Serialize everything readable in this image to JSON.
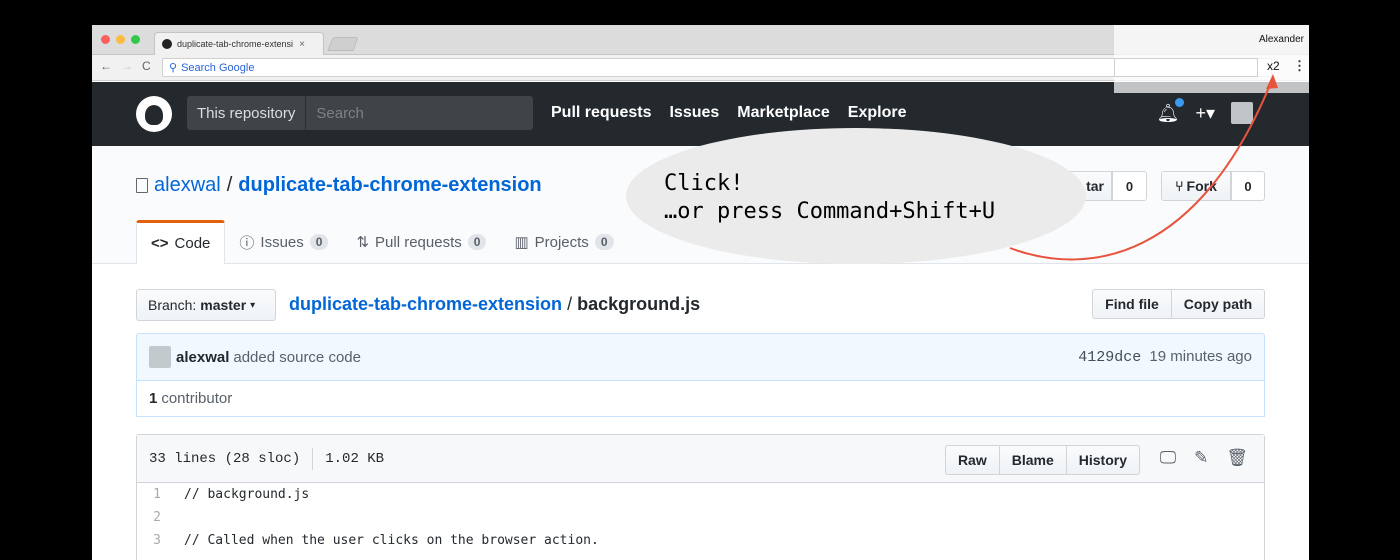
{
  "browser": {
    "tab_title": "duplicate-tab-chrome-extensi",
    "omnibox_placeholder": "Search Google",
    "profile_name": "Alexander",
    "extension_badge": "x2"
  },
  "github_header": {
    "scope_label": "This repository",
    "search_placeholder": "Search",
    "nav": [
      "Pull requests",
      "Issues",
      "Marketplace",
      "Explore"
    ]
  },
  "repo": {
    "owner": "alexwal",
    "separator": "/",
    "name": "duplicate-tab-chrome-extension",
    "star_label": "tar",
    "star_count": "0",
    "fork_label": "Fork",
    "fork_count": "0",
    "tabs": [
      {
        "label": "Code"
      },
      {
        "label": "Issues",
        "count": "0"
      },
      {
        "label": "Pull requests",
        "count": "0"
      },
      {
        "label": "Projects",
        "count": "0"
      }
    ]
  },
  "file_nav": {
    "branch_label": "Branch:",
    "branch_name": "master",
    "path_repo": "duplicate-tab-chrome-extension",
    "path_sep": "/",
    "path_file": "background.js",
    "find_file": "Find file",
    "copy_path": "Copy path"
  },
  "commit": {
    "author": "alexwal",
    "message": "added source code",
    "sha": "4129dce",
    "time": "19 minutes ago"
  },
  "contributors": {
    "count": "1",
    "label": "contributor"
  },
  "file": {
    "lines_info": "33 lines (28 sloc)",
    "size": "1.02 KB",
    "buttons": [
      "Raw",
      "Blame",
      "History"
    ],
    "code": [
      {
        "n": "1",
        "text": "// background.js"
      },
      {
        "n": "2",
        "text": ""
      },
      {
        "n": "3",
        "text": "// Called when the user clicks on the browser action."
      }
    ]
  },
  "callout": {
    "line1": "Click!",
    "line2": "…or press Command+Shift+U",
    "arrow_color": "#e8533e"
  }
}
